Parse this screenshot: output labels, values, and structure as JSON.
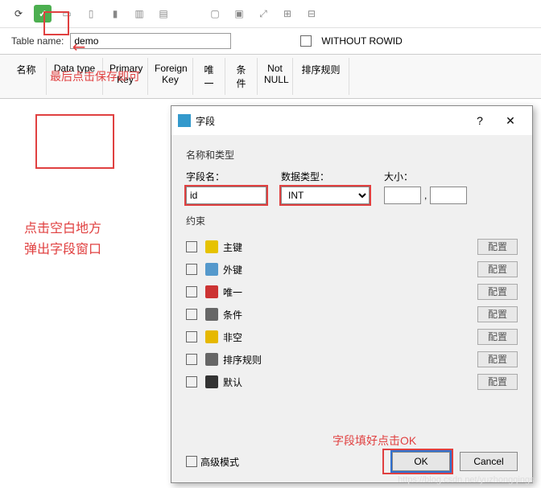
{
  "toolbar_green_check": "✓",
  "table_name_label": "Table name:",
  "table_name_value": "demo",
  "without_rowid_label": "WITHOUT ROWID",
  "headers": {
    "name": "名称",
    "datatype": "Data type",
    "pk": "Primary\nKey",
    "fk": "Foreign\nKey",
    "unique": "唯一",
    "cond": "条件",
    "notnull": "Not\nNULL",
    "collate": "排序规则"
  },
  "anno_save": "最后点击保存即可",
  "anno_blank1": "点击空白地方",
  "anno_blank2": "弹出字段窗口",
  "anno_ok": "字段填好点击OK",
  "dialog": {
    "title": "字段",
    "group_nametype": "名称和类型",
    "field_name_label": "字段名：",
    "field_name_value": "id",
    "datatype_label": "数据类型：",
    "datatype_value": "INT",
    "size_label": "大小：",
    "comma": ",",
    "group_constraint": "约束",
    "constraints": [
      {
        "label": "主键",
        "color": "#e6c200"
      },
      {
        "label": "外键",
        "color": "#5599cc"
      },
      {
        "label": "唯一",
        "color": "#cc3333"
      },
      {
        "label": "条件",
        "color": "#666"
      },
      {
        "label": "非空",
        "color": "#e6b800"
      },
      {
        "label": "排序规则",
        "color": "#666"
      },
      {
        "label": "默认",
        "color": "#333"
      }
    ],
    "config_btn": "配置",
    "advanced": "高级模式",
    "ok": "OK",
    "cancel": "Cancel",
    "help": "?",
    "close": "✕"
  },
  "watermark": "https://blog.csdn.net/yuzhongqingsi"
}
